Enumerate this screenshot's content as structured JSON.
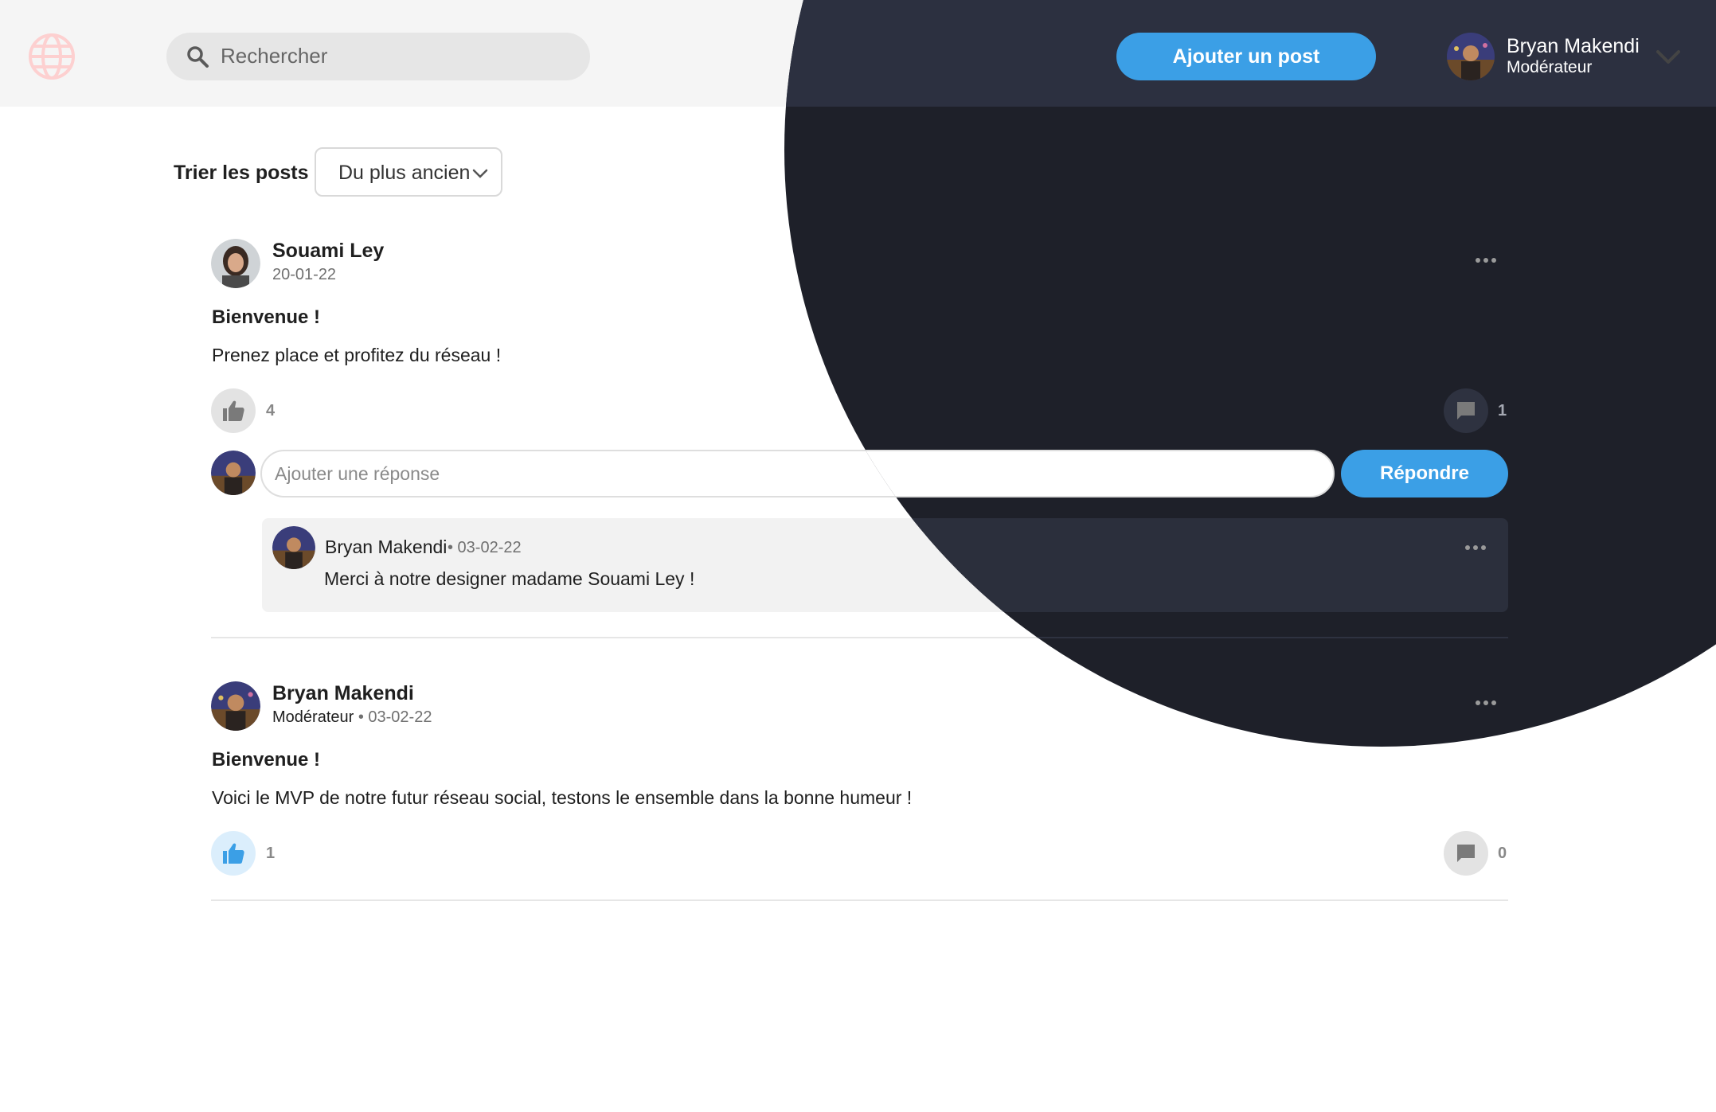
{
  "header": {
    "logo_icon": "globe-icon",
    "search_placeholder": "Rechercher",
    "add_post_label": "Ajouter un post",
    "user_name": "Bryan Makendi",
    "user_role": "Modérateur"
  },
  "sort": {
    "label": "Trier les posts",
    "selected": "Du plus ancien"
  },
  "posts": [
    {
      "author": "Souami Ley",
      "date": "20-01-22",
      "title": "Bienvenue !",
      "body": "Prenez place et profitez du réseau !",
      "likes": "4",
      "comments_count": "1",
      "reply_placeholder": "Ajouter une réponse",
      "reply_button": "Répondre",
      "comments": [
        {
          "author": "Bryan Makendi",
          "date": "• 03-02-22",
          "text": "Merci à notre designer madame Souami Ley !"
        }
      ]
    },
    {
      "author": "Bryan Makendi",
      "role": "Modérateur",
      "date": " • 03-02-22",
      "title": "Bienvenue !",
      "body": "Voici le MVP de notre futur réseau social, testons le ensemble dans la bonne humeur !",
      "likes": "1",
      "comments_count": "0"
    }
  ],
  "colors": {
    "accent": "#3b9fe6",
    "dark_bg": "#1e2029",
    "dark_header": "#2c3040",
    "logo": "#fdd0d0"
  }
}
